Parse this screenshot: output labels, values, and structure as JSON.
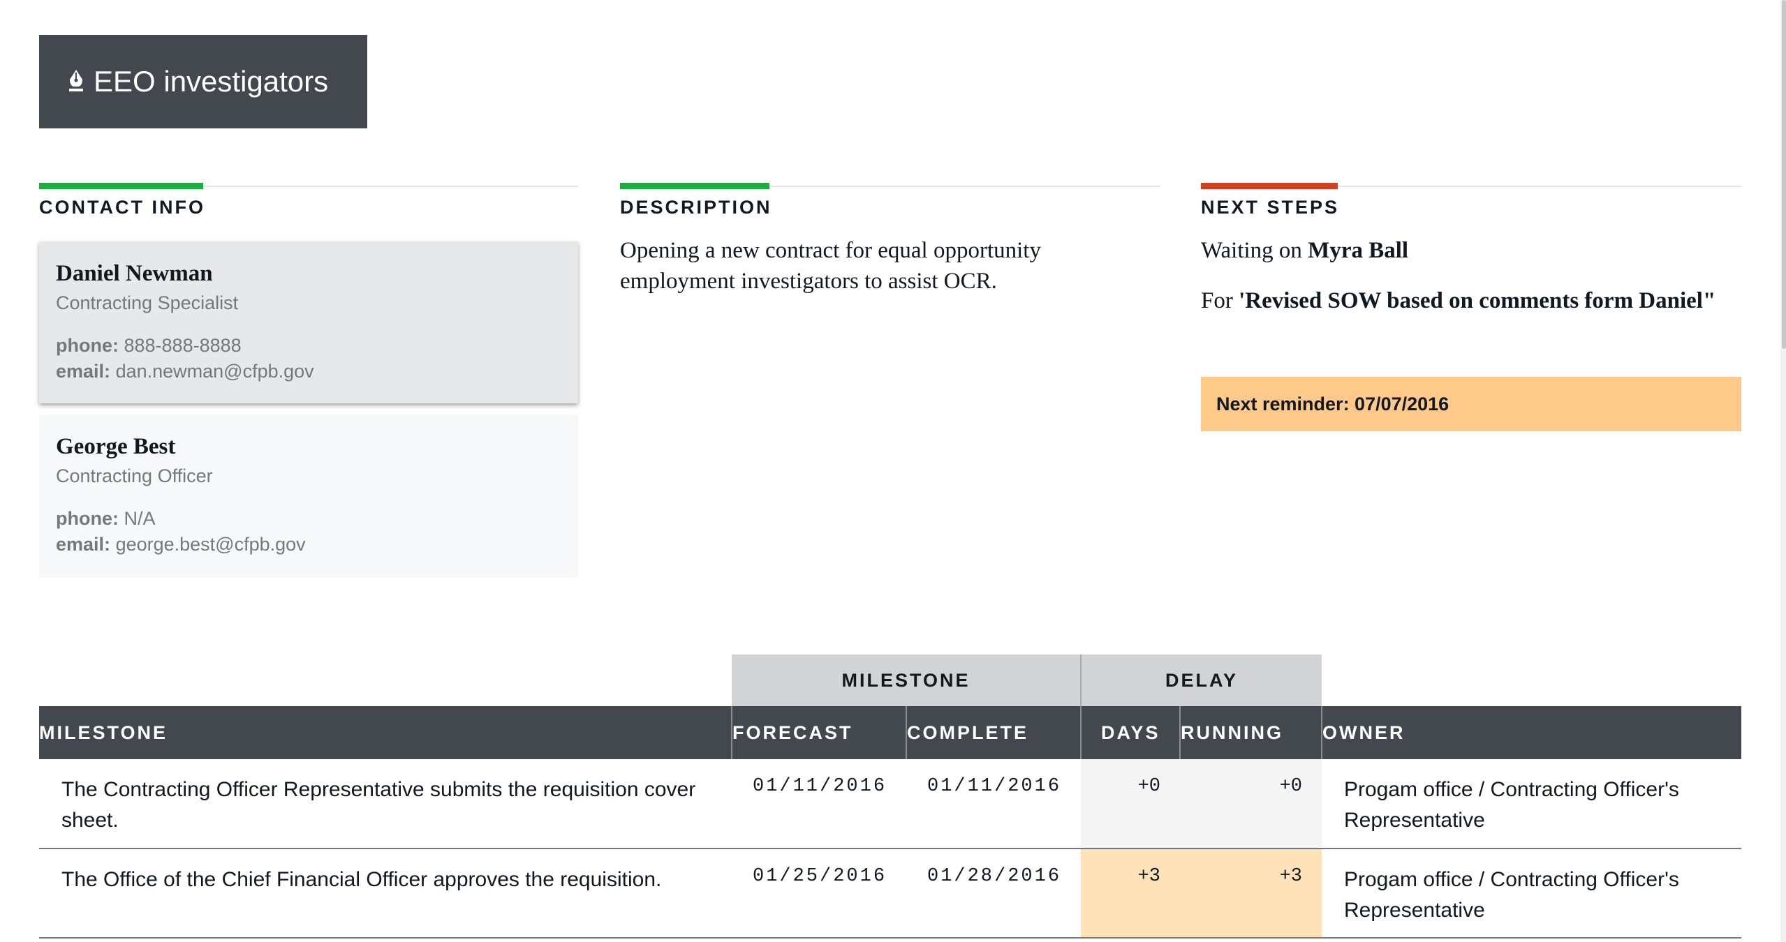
{
  "header": {
    "title": "EEO investigators",
    "icon": "pen-nib-icon"
  },
  "colors": {
    "header_bg": "#43484e",
    "contact_accent": "#20aa3f",
    "description_accent": "#20aa3f",
    "next_steps_accent": "#d14124",
    "reminder_bg": "#ffc98a",
    "delay_late_bg": "#ffe2b8"
  },
  "contact_info": {
    "heading": "CONTACT INFO",
    "contacts": [
      {
        "name": "Daniel Newman",
        "role": "Contracting Specialist",
        "phone_label": "phone:",
        "phone": "888-888-8888",
        "email_label": "email:",
        "email": "dan.newman@cfpb.gov"
      },
      {
        "name": "George Best",
        "role": "Contracting Officer",
        "phone_label": "phone:",
        "phone": "N/A",
        "email_label": "email:",
        "email": "george.best@cfpb.gov"
      }
    ]
  },
  "description": {
    "heading": "DESCRIPTION",
    "text": "Opening a new contract for equal opportunity employment investigators to assist OCR."
  },
  "next_steps": {
    "heading": "NEXT STEPS",
    "waiting_prefix": "Waiting on",
    "waiting_on": "Myra Ball",
    "for_prefix": "For",
    "for_item": "'Revised SOW based on comments form Daniel\"",
    "reminder": "Next reminder: 07/07/2016"
  },
  "milestones_table": {
    "group_headers": {
      "milestone": "MILESTONE",
      "delay": "DELAY"
    },
    "columns": [
      "MILESTONE",
      "FORECAST",
      "COMPLETE",
      "DAYS",
      "RUNNING",
      "OWNER"
    ],
    "rows": [
      {
        "milestone": "The Contracting Officer Representative submits the requisition cover sheet.",
        "forecast": "01/11/2016",
        "complete": "01/11/2016",
        "days": "+0",
        "running": "+0",
        "owner": "Progam office / Contracting Officer's Representative"
      },
      {
        "milestone": "The Office of the Chief Financial Officer approves the requisition.",
        "forecast": "01/25/2016",
        "complete": "01/28/2016",
        "days": "+3",
        "running": "+3",
        "owner": "Progam office / Contracting Officer's Representative"
      }
    ]
  }
}
